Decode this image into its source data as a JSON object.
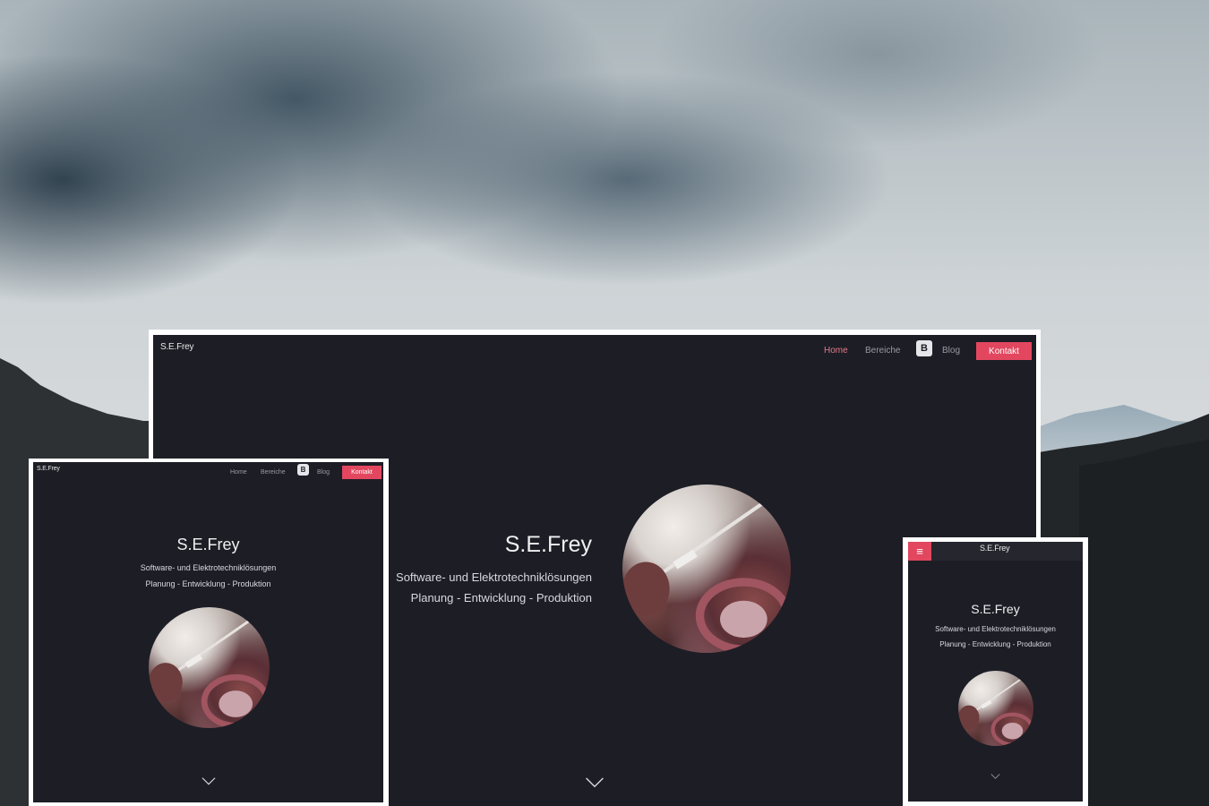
{
  "colors": {
    "screen_bg": "#1d1d25",
    "accent": "#e2475f",
    "active_link": "#e07a8c",
    "muted_link": "#9a9aa6",
    "frame": "#ffffff"
  },
  "site": {
    "brand": "S.E.Frey",
    "title": "S.E.Frey",
    "tagline_line1": "Software- und Elektrotechniklösungen",
    "tagline_line2": "Planung - Entwicklung - Produktion"
  },
  "nav": {
    "home": "Home",
    "bereiche": "Bereiche",
    "blog_icon": "blogger-icon",
    "blog_icon_glyph": "B",
    "blog": "Blog",
    "kontakt": "Kontakt"
  },
  "mobile": {
    "menu_icon": "hamburger-icon",
    "menu_glyph": "≡"
  },
  "icons": {
    "scroll_down": "chevron-down-icon"
  }
}
